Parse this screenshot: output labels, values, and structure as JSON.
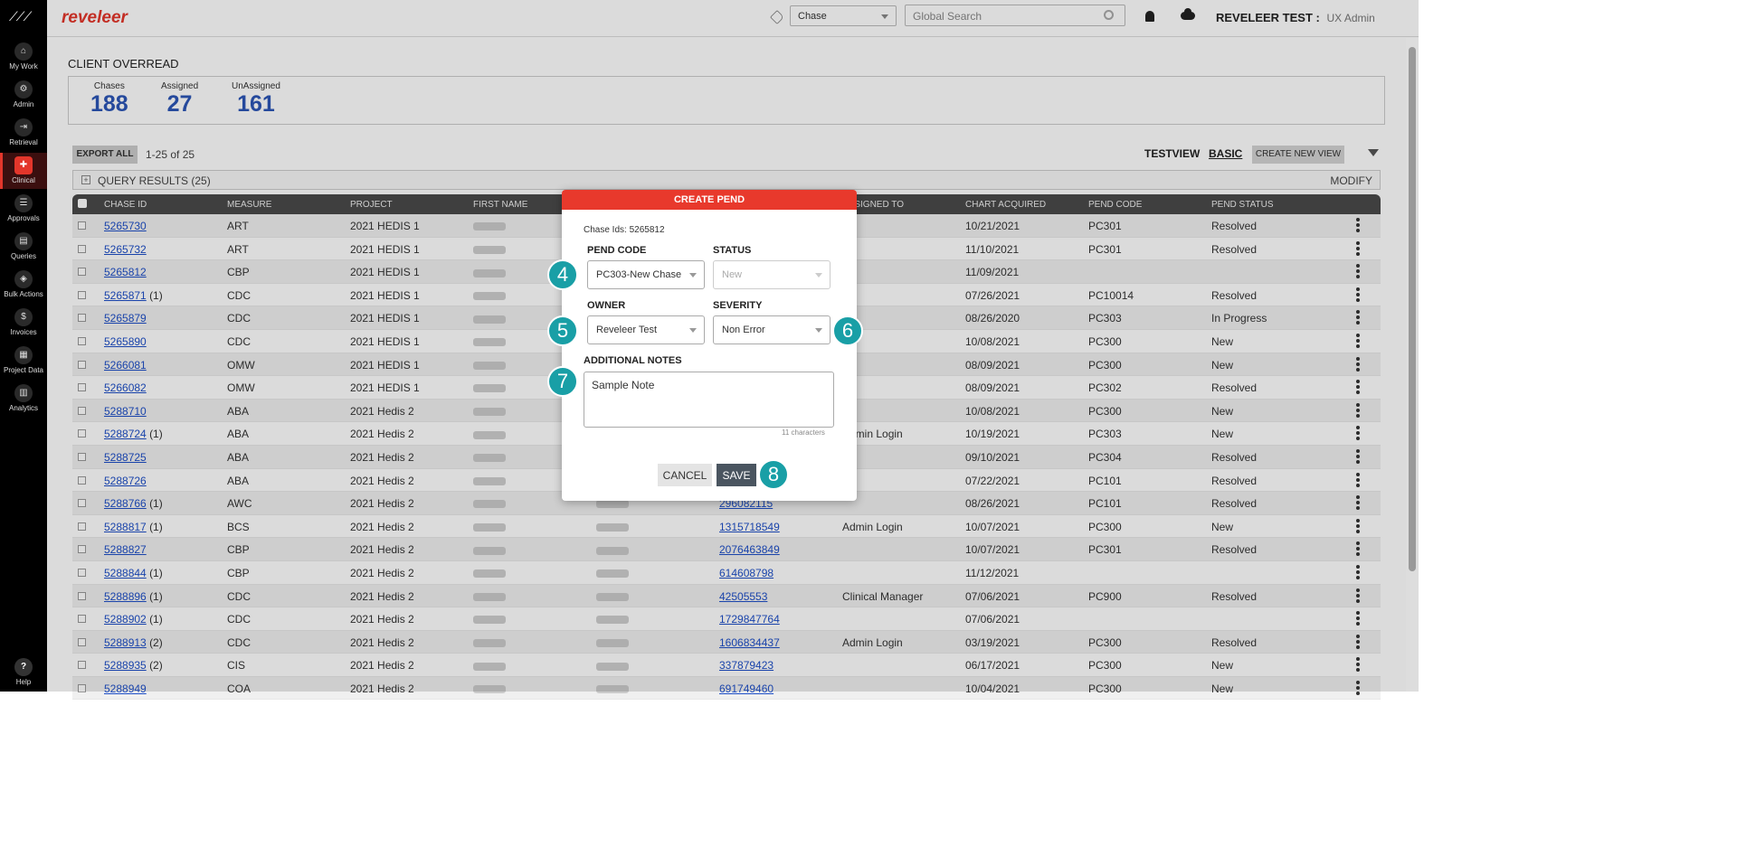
{
  "nav": {
    "items": [
      {
        "label": "My Work",
        "icon": "home-icon",
        "glyph": "⌂"
      },
      {
        "label": "Admin",
        "icon": "admin-icon",
        "glyph": "⚙"
      },
      {
        "label": "Retrieval",
        "icon": "retrieval-icon",
        "glyph": "⇥"
      },
      {
        "label": "Clinical",
        "icon": "clinical-icon",
        "glyph": "✚"
      },
      {
        "label": "Approvals",
        "icon": "approvals-icon",
        "glyph": "☰"
      },
      {
        "label": "Queries",
        "icon": "queries-icon",
        "glyph": "▤"
      },
      {
        "label": "Bulk Actions",
        "icon": "bulk-actions-icon",
        "glyph": "◈"
      },
      {
        "label": "Invoices",
        "icon": "invoices-icon",
        "glyph": "$"
      },
      {
        "label": "Project Data",
        "icon": "project-data-icon",
        "glyph": "▦"
      },
      {
        "label": "Analytics",
        "icon": "analytics-icon",
        "glyph": "▥"
      }
    ],
    "help": "Help"
  },
  "header": {
    "brand": "reveleer",
    "chase_select": "Chase",
    "search_placeholder": "Global Search",
    "user_name": "REVELEER TEST :",
    "user_role": "UX Admin"
  },
  "page": {
    "title": "CLIENT OVERREAD",
    "stats": [
      {
        "label": "Chases",
        "value": "188"
      },
      {
        "label": "Assigned",
        "value": "27"
      },
      {
        "label": "UnAssigned",
        "value": "161"
      }
    ],
    "export_all": "EXPORT ALL",
    "range": "1-25  of  25",
    "testview": "TESTVIEW",
    "basic": "BASIC",
    "create_new_view": "CREATE NEW VIEW",
    "query_results": "QUERY RESULTS (25)",
    "modify": "MODIFY"
  },
  "grid": {
    "columns": [
      "CHASE ID",
      "MEASURE",
      "PROJECT",
      "FIRST NAME",
      "",
      "",
      "ASSIGNED TO",
      "CHART ACQUIRED",
      "PEND CODE",
      "PEND STATUS"
    ],
    "rows": [
      {
        "id": "5265730",
        "suffix": "",
        "measure": "ART",
        "project": "2021 HEDIS 1",
        "member": "",
        "assigned": "",
        "acquired": "10/21/2021",
        "pend": "PC301",
        "status": "Resolved"
      },
      {
        "id": "5265732",
        "suffix": "",
        "measure": "ART",
        "project": "2021 HEDIS 1",
        "member": "",
        "assigned": "",
        "acquired": "11/10/2021",
        "pend": "PC301",
        "status": "Resolved"
      },
      {
        "id": "5265812",
        "suffix": "",
        "measure": "CBP",
        "project": "2021 HEDIS 1",
        "member": "",
        "assigned": "",
        "acquired": "11/09/2021",
        "pend": "",
        "status": ""
      },
      {
        "id": "5265871",
        "suffix": "(1)",
        "measure": "CDC",
        "project": "2021 HEDIS 1",
        "member": "",
        "assigned": "",
        "acquired": "07/26/2021",
        "pend": "PC10014",
        "status": "Resolved"
      },
      {
        "id": "5265879",
        "suffix": "",
        "measure": "CDC",
        "project": "2021 HEDIS 1",
        "member": "",
        "assigned": "",
        "acquired": "08/26/2020",
        "pend": "PC303",
        "status": "In Progress"
      },
      {
        "id": "5265890",
        "suffix": "",
        "measure": "CDC",
        "project": "2021 HEDIS 1",
        "member": "",
        "assigned": "",
        "acquired": "10/08/2021",
        "pend": "PC300",
        "status": "New"
      },
      {
        "id": "5266081",
        "suffix": "",
        "measure": "OMW",
        "project": "2021 HEDIS 1",
        "member": "",
        "assigned": "",
        "acquired": "08/09/2021",
        "pend": "PC300",
        "status": "New"
      },
      {
        "id": "5266082",
        "suffix": "",
        "measure": "OMW",
        "project": "2021 HEDIS 1",
        "member": "",
        "assigned": "",
        "acquired": "08/09/2021",
        "pend": "PC302",
        "status": "Resolved"
      },
      {
        "id": "5288710",
        "suffix": "",
        "measure": "ABA",
        "project": "2021 Hedis 2",
        "member": "",
        "assigned": "",
        "acquired": "10/08/2021",
        "pend": "PC300",
        "status": "New"
      },
      {
        "id": "5288724",
        "suffix": "(1)",
        "measure": "ABA",
        "project": "2021 Hedis 2",
        "member": "",
        "assigned": "Admin Login",
        "acquired": "10/19/2021",
        "pend": "PC303",
        "status": "New"
      },
      {
        "id": "5288725",
        "suffix": "",
        "measure": "ABA",
        "project": "2021 Hedis 2",
        "member": "",
        "assigned": "",
        "acquired": "09/10/2021",
        "pend": "PC304",
        "status": "Resolved"
      },
      {
        "id": "5288726",
        "suffix": "",
        "measure": "ABA",
        "project": "2021 Hedis 2",
        "member": "",
        "assigned": "",
        "acquired": "07/22/2021",
        "pend": "PC101",
        "status": "Resolved"
      },
      {
        "id": "5288766",
        "suffix": "(1)",
        "measure": "AWC",
        "project": "2021 Hedis 2",
        "member": "296082115",
        "assigned": "",
        "acquired": "08/26/2021",
        "pend": "PC101",
        "status": "Resolved"
      },
      {
        "id": "5288817",
        "suffix": "(1)",
        "measure": "BCS",
        "project": "2021 Hedis 2",
        "member": "1315718549",
        "assigned": "Admin Login",
        "acquired": "10/07/2021",
        "pend": "PC300",
        "status": "New"
      },
      {
        "id": "5288827",
        "suffix": "",
        "measure": "CBP",
        "project": "2021 Hedis 2",
        "member": "2076463849",
        "assigned": "",
        "acquired": "10/07/2021",
        "pend": "PC301",
        "status": "Resolved"
      },
      {
        "id": "5288844",
        "suffix": "(1)",
        "measure": "CBP",
        "project": "2021 Hedis 2",
        "member": "614608798",
        "assigned": "",
        "acquired": "11/12/2021",
        "pend": "",
        "status": ""
      },
      {
        "id": "5288896",
        "suffix": "(1)",
        "measure": "CDC",
        "project": "2021 Hedis 2",
        "member": "42505553",
        "assigned": "Clinical Manager",
        "acquired": "07/06/2021",
        "pend": "PC900",
        "status": "Resolved"
      },
      {
        "id": "5288902",
        "suffix": "(1)",
        "measure": "CDC",
        "project": "2021 Hedis 2",
        "member": "1729847764",
        "assigned": "",
        "acquired": "07/06/2021",
        "pend": "",
        "status": ""
      },
      {
        "id": "5288913",
        "suffix": "(2)",
        "measure": "CDC",
        "project": "2021 Hedis 2",
        "member": "1606834437",
        "assigned": "Admin Login",
        "acquired": "03/19/2021",
        "pend": "PC300",
        "status": "Resolved"
      },
      {
        "id": "5288935",
        "suffix": "(2)",
        "measure": "CIS",
        "project": "2021 Hedis 2",
        "member": "337879423",
        "assigned": "",
        "acquired": "06/17/2021",
        "pend": "PC300",
        "status": "New"
      },
      {
        "id": "5288949",
        "suffix": "",
        "measure": "COA",
        "project": "2021 Hedis 2",
        "member": "691749460",
        "assigned": "",
        "acquired": "10/04/2021",
        "pend": "PC300",
        "status": "New"
      }
    ]
  },
  "modal": {
    "title": "CREATE PEND",
    "chase_ids": "Chase Ids: 5265812",
    "pend_code_label": "PEND CODE",
    "pend_code_value": "PC303-New Chase",
    "status_label": "STATUS",
    "status_value": "New",
    "owner_label": "OWNER",
    "owner_value": "Reveleer Test",
    "severity_label": "SEVERITY",
    "severity_value": "Non Error",
    "notes_label": "ADDITIONAL NOTES",
    "notes_value": "Sample Note",
    "char_count": "11 characters",
    "cancel": "CANCEL",
    "save": "SAVE"
  },
  "callouts": [
    "4",
    "5",
    "6",
    "7",
    "8"
  ],
  "colors": {
    "brand": "#e3362b",
    "modal_header": "#e8392c",
    "callout": "#199fa6",
    "link": "#1e4fc7",
    "stat": "#2c56b6"
  }
}
